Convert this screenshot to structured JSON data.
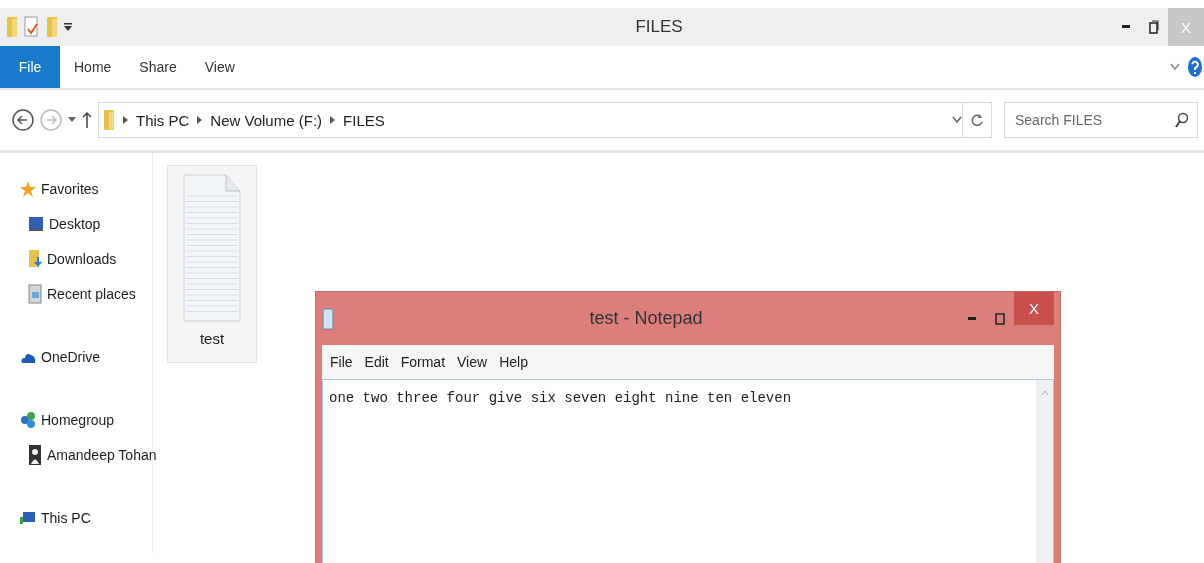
{
  "explorer": {
    "title": "FILES",
    "close_label": "X",
    "ribbon_tabs": [
      {
        "label": "File",
        "selected": true
      },
      {
        "label": "Home",
        "selected": false
      },
      {
        "label": "Share",
        "selected": false
      },
      {
        "label": "View",
        "selected": false
      }
    ],
    "breadcrumb": [
      "This PC",
      "New Volume (F:)",
      "FILES"
    ],
    "search": {
      "placeholder": "Search FILES"
    },
    "sidebar": [
      {
        "label": "Favorites",
        "kind": "star",
        "children": [
          {
            "label": "Desktop",
            "kind": "desktop"
          },
          {
            "label": "Downloads",
            "kind": "downloads"
          },
          {
            "label": "Recent places",
            "kind": "recent"
          }
        ]
      },
      {
        "label": "OneDrive",
        "kind": "cloud"
      },
      {
        "label": "Homegroup",
        "kind": "homegroup",
        "children": [
          {
            "label": "Amandeep Tohan",
            "kind": "user"
          }
        ]
      },
      {
        "label": "This PC",
        "kind": "pc"
      }
    ],
    "files": [
      {
        "name": "test",
        "selected": true
      }
    ]
  },
  "notepad": {
    "title": "test - Notepad",
    "close_label": "X",
    "active": true,
    "menu": [
      "File",
      "Edit",
      "Format",
      "View",
      "Help"
    ],
    "text": "one two three four give six seven eight nine ten eleven"
  }
}
